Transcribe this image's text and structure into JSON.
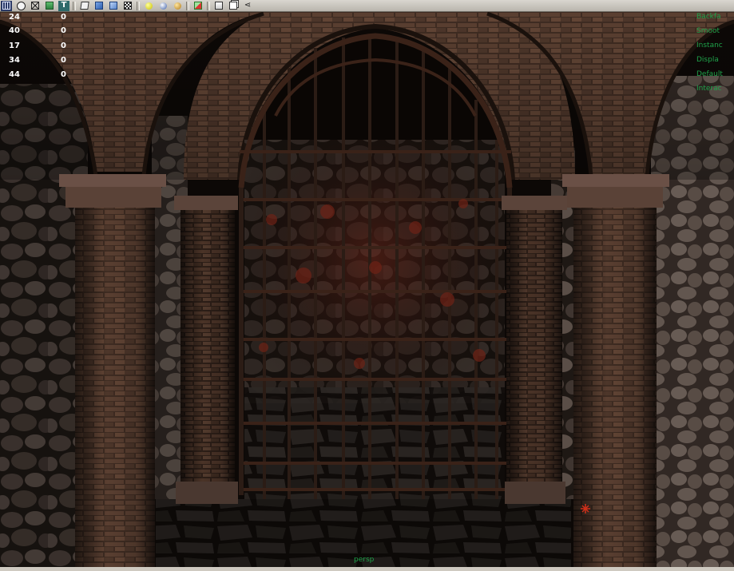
{
  "toolbar": {
    "icons": [
      "grid-icon",
      "circle-select-icon",
      "wireframe-icon",
      "texture-icon",
      "text-icon",
      "cube-icon",
      "shaded-cube-icon",
      "solid-cube-icon",
      "checker-icon",
      "light-yellow-icon",
      "light-blue-icon",
      "light-gold-icon",
      "render-region-icon",
      "box-icon",
      "duplicate-icon",
      "share-icon"
    ]
  },
  "stats": {
    "rows": [
      {
        "label": "24",
        "value": "0"
      },
      {
        "label": "40",
        "value": "0"
      },
      {
        "label": "17",
        "value": "0"
      },
      {
        "label": "34",
        "value": "0"
      },
      {
        "label": "44",
        "value": "0"
      }
    ]
  },
  "hud_right": [
    "Backfa",
    "Smoot",
    "Instanc",
    "Displa",
    "Default",
    "Interac"
  ],
  "camera_label": "persp",
  "colors": {
    "hud_green": "#1fa24a",
    "brick": "#4a3428",
    "stone": "#5e514b",
    "iron": "#2a1a14",
    "rust": "#7a2418"
  }
}
